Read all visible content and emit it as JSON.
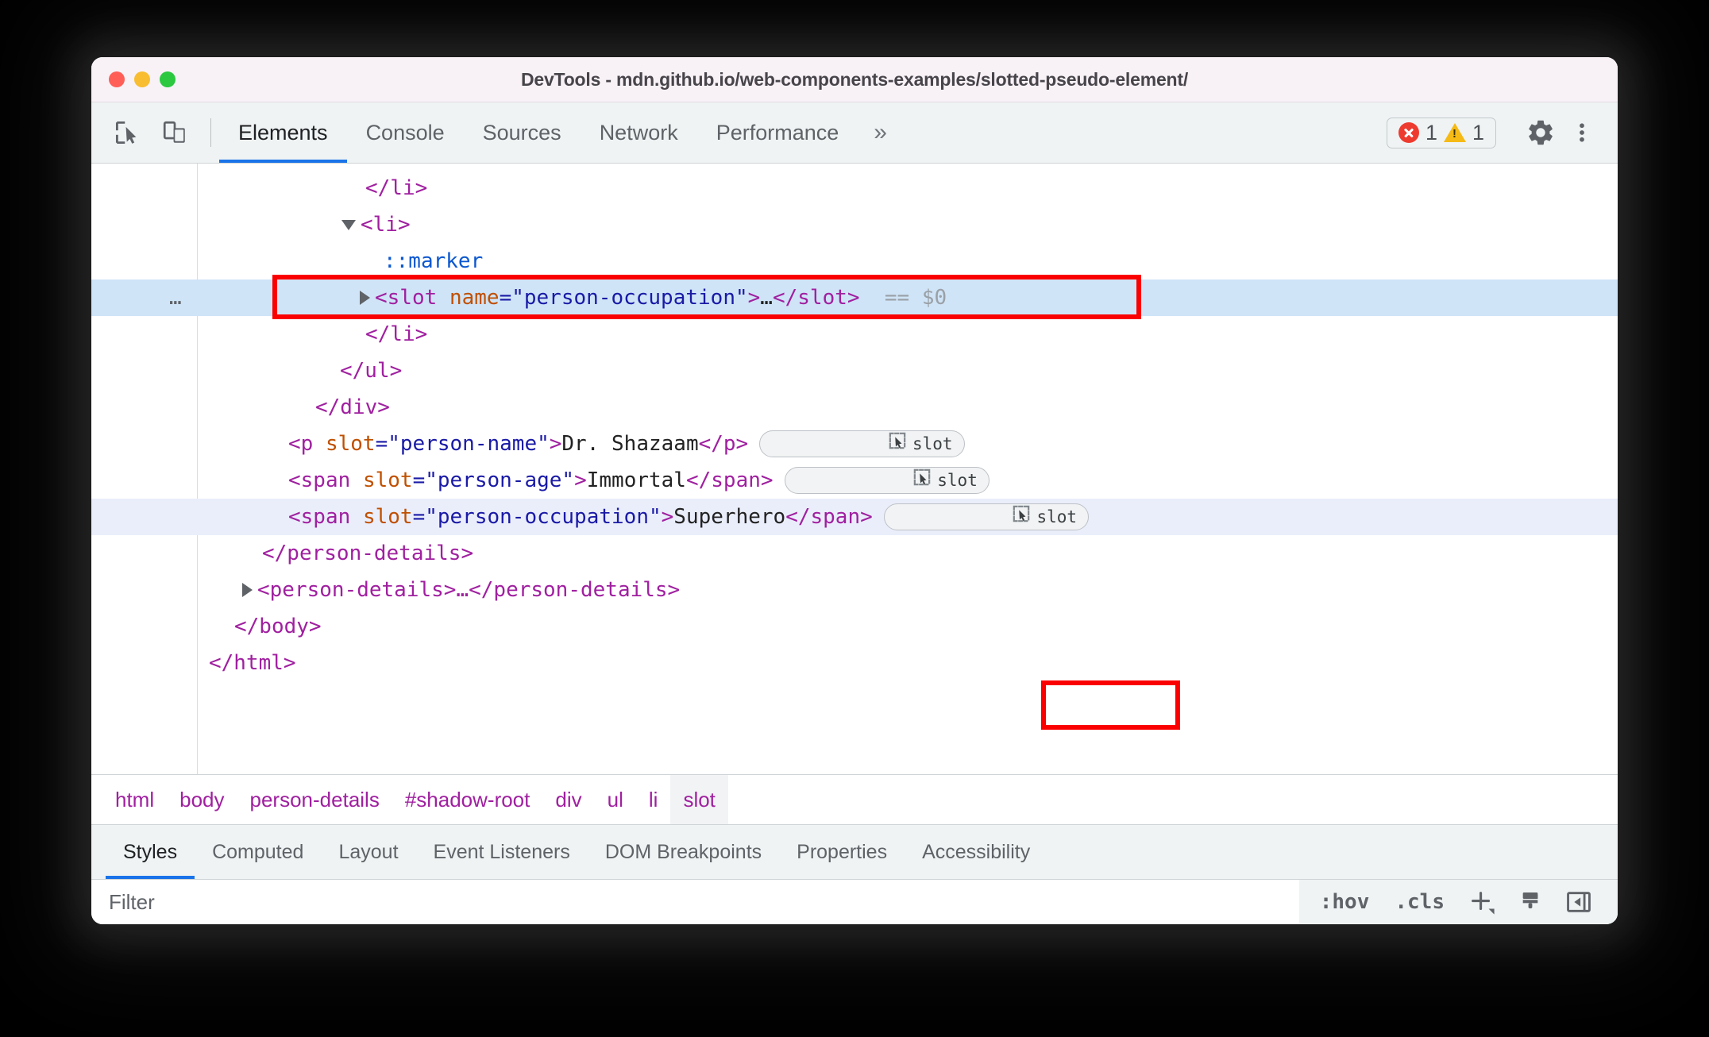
{
  "window": {
    "title": "DevTools - mdn.github.io/web-components-examples/slotted-pseudo-element/",
    "traffic_lights": [
      "close",
      "minimize",
      "maximize"
    ]
  },
  "toolbar": {
    "inspect_icon": "inspect-cursor-icon",
    "device_icon": "device-toolbar-icon",
    "tabs": [
      {
        "label": "Elements",
        "active": true
      },
      {
        "label": "Console",
        "active": false
      },
      {
        "label": "Sources",
        "active": false
      },
      {
        "label": "Network",
        "active": false
      },
      {
        "label": "Performance",
        "active": false
      }
    ],
    "more_tabs_label": "»",
    "issues": {
      "error_icon": "error-circle-icon",
      "error_count": "1",
      "warning_icon": "warning-triangle-icon",
      "warning_count": "1",
      "error_color": "#ee3b2f",
      "warning_color": "#f5ba15"
    },
    "settings_icon": "gear-icon",
    "menu_icon": "three-dot-menu-icon"
  },
  "dom_tree": {
    "accent_selected_bg": "#cfe4f7",
    "tag_color": "#a020a0",
    "attr_name_color": "#c05000",
    "attr_value_color": "#1a1aa6",
    "pseudo_color": "#0b57d0",
    "annotation_color": "#fa0000",
    "rows": [
      {
        "id": "close-li-1",
        "text": "</li>"
      },
      {
        "id": "open-li",
        "text": "<li>"
      },
      {
        "id": "marker",
        "text": "::marker"
      },
      {
        "id": "slot-occupation",
        "tag": "slot",
        "attr_name": "name",
        "attr_value": "person-occupation",
        "ellipsis": "…",
        "suffix": "== $0"
      },
      {
        "id": "close-li-2",
        "text": "</li>"
      },
      {
        "id": "close-ul",
        "text": "</ul>"
      },
      {
        "id": "close-div",
        "text": "</div>"
      },
      {
        "id": "p-person-name",
        "tag": "p",
        "attr_name": "slot",
        "attr_value": "person-name",
        "content": "Dr. Shazaam",
        "badge": "slot"
      },
      {
        "id": "span-person-age",
        "tag": "span",
        "attr_name": "slot",
        "attr_value": "person-age",
        "content": "Immortal",
        "badge": "slot"
      },
      {
        "id": "span-person-occ",
        "tag": "span",
        "attr_name": "slot",
        "attr_value": "person-occupation",
        "content": "Superhero",
        "badge": "slot"
      },
      {
        "id": "close-person-details",
        "text": "</person-details>"
      },
      {
        "id": "person-details-collapsed",
        "text": "<person-details>…</person-details>"
      },
      {
        "id": "close-body",
        "text": "</body>"
      },
      {
        "id": "close-html",
        "text": "</html>"
      }
    ],
    "row_ellipsis_menu": "…",
    "badge_label": "slot",
    "badge_icon": "slot-select-icon"
  },
  "breadcrumb": {
    "items": [
      {
        "label": "html",
        "selected": false
      },
      {
        "label": "body",
        "selected": false
      },
      {
        "label": "person-details",
        "selected": false
      },
      {
        "label": "#shadow-root",
        "selected": false
      },
      {
        "label": "div",
        "selected": false
      },
      {
        "label": "ul",
        "selected": false
      },
      {
        "label": "li",
        "selected": false
      },
      {
        "label": "slot",
        "selected": true
      }
    ]
  },
  "styles_pane": {
    "tabs": [
      {
        "label": "Styles",
        "active": true
      },
      {
        "label": "Computed",
        "active": false
      },
      {
        "label": "Layout",
        "active": false
      },
      {
        "label": "Event Listeners",
        "active": false
      },
      {
        "label": "DOM Breakpoints",
        "active": false
      },
      {
        "label": "Properties",
        "active": false
      },
      {
        "label": "Accessibility",
        "active": false
      }
    ],
    "filter": {
      "placeholder": "Filter",
      "value": ""
    },
    "actions": {
      "hov_label": ":hov",
      "cls_label": ".cls",
      "new_rule_icon": "plus-icon",
      "style_sheet_icon": "paint-bucket-icon",
      "toggle_sidebar_icon": "collapse-sidebar-icon"
    }
  }
}
